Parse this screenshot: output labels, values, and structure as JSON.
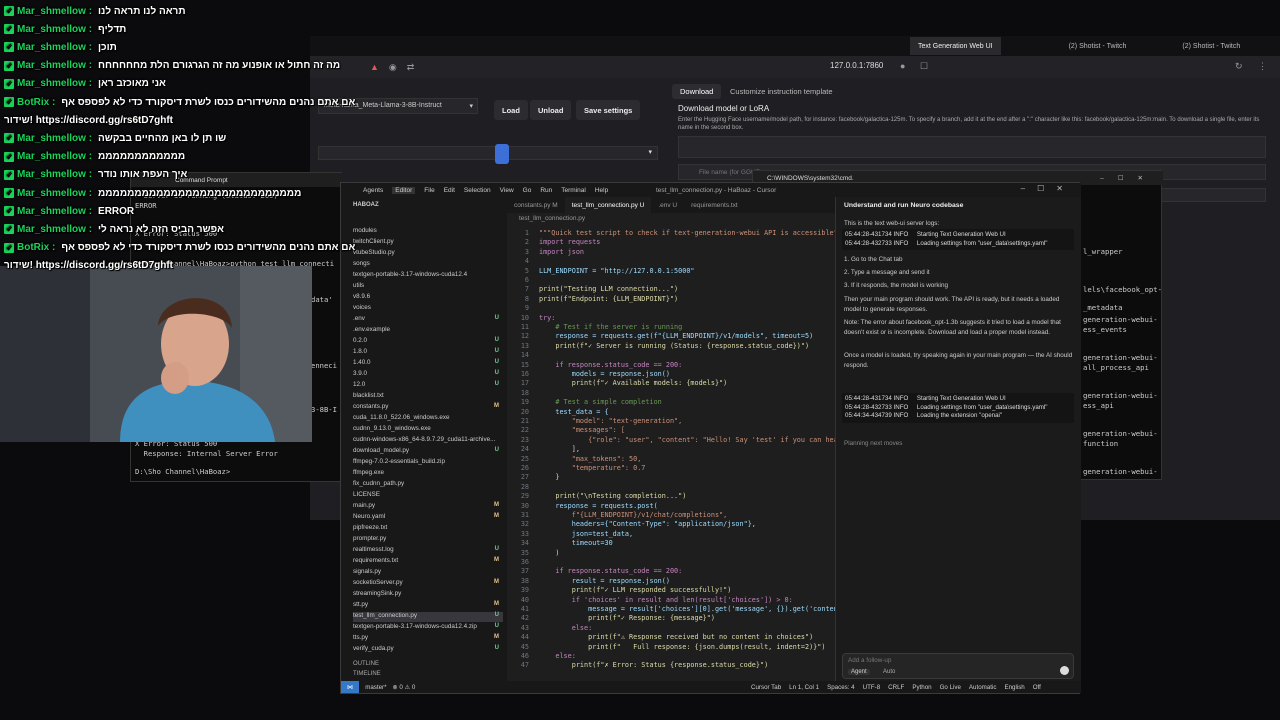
{
  "browser": {
    "tabs": [
      {
        "label": "Text Generation Web UI",
        "active": true
      },
      {
        "label": "(2) Shotist - Twitch",
        "active": false
      },
      {
        "label": "(2) Shotist - Twitch",
        "active": false
      }
    ],
    "url": "127.0.0.1:7860"
  },
  "webui": {
    "model_name": "meta-llama_Meta-Llama-3-8B-Instruct",
    "load_label": "Load",
    "unload_label": "Unload",
    "save_label": "Save settings",
    "tab_download": "Download",
    "tab_customize": "Customize instruction template",
    "download_heading": "Download model or LoRA",
    "download_help": "Enter the Hugging Face username/model path, for instance: facebook/galactica-125m. To specify a branch, add it at the end after a \":\" character like this: facebook/galactica-125m:main. To download a single file, enter its name in the second box.",
    "file_name_placeholder": "File name (for GGUF",
    "side_items": [
      "l_wrapper",
      "lels\\facebook_opt-",
      "_metadata",
      "generation-webui-",
      "ess_events",
      "generation-webui-",
      "all_process_api",
      "generation-webui-",
      "ess_api",
      "generation-webui-",
      "function",
      "generation-webui-"
    ],
    "left_labels": [
      "Model",
      "Main option",
      "Character",
      "Must be greater than 0",
      "ctx-size"
    ]
  },
  "cursor": {
    "menu": [
      "Agents",
      "Editor",
      "File",
      "Edit",
      "Selection",
      "View",
      "Go",
      "Run",
      "Terminal",
      "Help"
    ],
    "title": "test_llm_connection.py - HaBoaz - Cursor",
    "explorer_title": "HABOAZ",
    "files": [
      {
        "name": "modules",
        "badge": ""
      },
      {
        "name": "twitchClient.py",
        "badge": ""
      },
      {
        "name": "vtubeStudio.py",
        "badge": ""
      },
      {
        "name": "songs",
        "badge": ""
      },
      {
        "name": "textgen-portable-3.17-windows-cuda12.4",
        "badge": ""
      },
      {
        "name": "utils",
        "badge": ""
      },
      {
        "name": "v8.9.6",
        "badge": ""
      },
      {
        "name": "voices",
        "badge": ""
      },
      {
        "name": ".env",
        "badge": "U"
      },
      {
        "name": ".env.example",
        "badge": ""
      },
      {
        "name": "0.2.0",
        "badge": "U"
      },
      {
        "name": "1.8.0",
        "badge": "U"
      },
      {
        "name": "1.40.0",
        "badge": "U"
      },
      {
        "name": "3.9.0",
        "badge": "U"
      },
      {
        "name": "12.0",
        "badge": "U"
      },
      {
        "name": "blacklist.txt",
        "badge": ""
      },
      {
        "name": "constants.py",
        "badge": "M"
      },
      {
        "name": "cuda_11.8.0_522.06_windows.exe",
        "badge": ""
      },
      {
        "name": "cudnn_9.13.0_windows.exe",
        "badge": ""
      },
      {
        "name": "cudnn-windows-x86_64-8.9.7.29_cuda11-archive...",
        "badge": ""
      },
      {
        "name": "download_model.py",
        "badge": "U"
      },
      {
        "name": "ffmpeg-7.0.2-essentials_build.zip",
        "badge": ""
      },
      {
        "name": "ffmpeg.exe",
        "badge": ""
      },
      {
        "name": "fix_cudnn_path.py",
        "badge": ""
      },
      {
        "name": "LICENSE",
        "badge": ""
      },
      {
        "name": "main.py",
        "badge": "M"
      },
      {
        "name": "Neuro.yaml",
        "badge": "M"
      },
      {
        "name": "pipfreeze.txt",
        "badge": ""
      },
      {
        "name": "prompter.py",
        "badge": ""
      },
      {
        "name": "realtimesst.log",
        "badge": "U"
      },
      {
        "name": "requirements.txt",
        "badge": "M"
      },
      {
        "name": "signals.py",
        "badge": ""
      },
      {
        "name": "socketioServer.py",
        "badge": "M"
      },
      {
        "name": "streamingSink.py",
        "badge": ""
      },
      {
        "name": "stt.py",
        "badge": "M"
      },
      {
        "name": "test_llm_connection.py",
        "badge": "U",
        "selected": true
      },
      {
        "name": "textgen-portable-3.17-windows-cuda12.4.zip",
        "badge": "U"
      },
      {
        "name": "tts.py",
        "badge": "M"
      },
      {
        "name": "verify_cuda.py",
        "badge": "U"
      }
    ],
    "outline_label": "OUTLINE",
    "timeline_label": "TIMELINE",
    "editor_tabs": [
      {
        "label": "constants.py M",
        "active": false
      },
      {
        "label": "test_llm_connection.py U",
        "active": true
      },
      {
        "label": ".env U",
        "active": false
      },
      {
        "label": "requirements.txt",
        "active": false
      }
    ],
    "breadcrumb": "test_llm_connection.py",
    "code_lines": [
      {
        "n": "1",
        "t": "\"\"\"Quick test script to check if text-generation-webui API is accessible\"\"\"",
        "c": "st"
      },
      {
        "n": "2",
        "t": "import requests",
        "c": "kw"
      },
      {
        "n": "3",
        "t": "import json",
        "c": "kw"
      },
      {
        "n": "4",
        "t": "",
        "c": ""
      },
      {
        "n": "5",
        "t": "LLM_ENDPOINT = \"http://127.0.0.1:5000\"",
        "c": "vr"
      },
      {
        "n": "6",
        "t": "",
        "c": ""
      },
      {
        "n": "7",
        "t": "print(\"Testing LLM connection...\")",
        "c": "fn"
      },
      {
        "n": "8",
        "t": "print(f\"Endpoint: {LLM_ENDPOINT}\")",
        "c": "fn"
      },
      {
        "n": "9",
        "t": "",
        "c": ""
      },
      {
        "n": "10",
        "t": "try:",
        "c": "kw"
      },
      {
        "n": "11",
        "t": "    # Test if the server is running",
        "c": "cm"
      },
      {
        "n": "12",
        "t": "    response = requests.get(f\"{LLM_ENDPOINT}/v1/models\", timeout=5)",
        "c": "vr"
      },
      {
        "n": "13",
        "t": "    print(f\"✓ Server is running (Status: {response.status_code})\")",
        "c": "fn"
      },
      {
        "n": "14",
        "t": "",
        "c": ""
      },
      {
        "n": "15",
        "t": "    if response.status_code == 200:",
        "c": "kw"
      },
      {
        "n": "16",
        "t": "        models = response.json()",
        "c": "vr"
      },
      {
        "n": "17",
        "t": "        print(f\"✓ Available models: {models}\")",
        "c": "fn"
      },
      {
        "n": "18",
        "t": "",
        "c": ""
      },
      {
        "n": "19",
        "t": "    # Test a simple completion",
        "c": "cm"
      },
      {
        "n": "20",
        "t": "    test_data = {",
        "c": "vr"
      },
      {
        "n": "21",
        "t": "        \"model\": \"text-generation\",",
        "c": "st"
      },
      {
        "n": "22",
        "t": "        \"messages\": [",
        "c": "st"
      },
      {
        "n": "23",
        "t": "            {\"role\": \"user\", \"content\": \"Hello! Say 'test' if you can hear me",
        "c": "st"
      },
      {
        "n": "24",
        "t": "        ],",
        "c": ""
      },
      {
        "n": "25",
        "t": "        \"max_tokens\": 50,",
        "c": "st"
      },
      {
        "n": "26",
        "t": "        \"temperature\": 0.7",
        "c": "st"
      },
      {
        "n": "27",
        "t": "    }",
        "c": ""
      },
      {
        "n": "28",
        "t": "",
        "c": ""
      },
      {
        "n": "29",
        "t": "    print(\"\\nTesting completion...\")",
        "c": "fn"
      },
      {
        "n": "30",
        "t": "    response = requests.post(",
        "c": "vr"
      },
      {
        "n": "31",
        "t": "        f\"{LLM_ENDPOINT}/v1/chat/completions\",",
        "c": "st"
      },
      {
        "n": "32",
        "t": "        headers={\"Content-Type\": \"application/json\"},",
        "c": "vr"
      },
      {
        "n": "33",
        "t": "        json=test_data,",
        "c": "vr"
      },
      {
        "n": "34",
        "t": "        timeout=30",
        "c": "vr"
      },
      {
        "n": "35",
        "t": "    )",
        "c": ""
      },
      {
        "n": "36",
        "t": "",
        "c": ""
      },
      {
        "n": "37",
        "t": "    if response.status_code == 200:",
        "c": "kw"
      },
      {
        "n": "38",
        "t": "        result = response.json()",
        "c": "vr"
      },
      {
        "n": "39",
        "t": "        print(f\"✓ LLM responded successfully!\")",
        "c": "fn"
      },
      {
        "n": "40",
        "t": "        if 'choices' in result and len(result['choices']) > 0:",
        "c": "kw"
      },
      {
        "n": "41",
        "t": "            message = result['choices'][0].get('message', {}).get('content',",
        "c": "vr"
      },
      {
        "n": "42",
        "t": "            print(f\"✓ Response: {message}\")",
        "c": "fn"
      },
      {
        "n": "43",
        "t": "        else:",
        "c": "kw"
      },
      {
        "n": "44",
        "t": "            print(f\"⚠ Response received but no content in choices\")",
        "c": "fn"
      },
      {
        "n": "45",
        "t": "            print(f\"   Full response: {json.dumps(result, indent=2)}\")",
        "c": "fn"
      },
      {
        "n": "46",
        "t": "    else:",
        "c": "kw"
      },
      {
        "n": "47",
        "t": "        print(f\"✗ Error: Status {response.status_code}\")",
        "c": "fn"
      }
    ],
    "chat_title": "Understand and run Neuro codebase",
    "chat_intro": "This is the text web-ui server logs:",
    "log1": "05:44:28-431734 INFO     Starting Text Generation Web UI\n05:44:28-432733 INFO     Loading settings from \"user_data\\settings.yaml\"",
    "chat_steps": [
      "1. Go to the Chat tab",
      "2. Type a message and send it",
      "3. If it responds, the model is working"
    ],
    "chat_p1": "Then your main program should work. The API is ready, but it needs a loaded model to generate responses.",
    "chat_p2": "Note: The error about facebook_opt-1.3b suggests it tried to load a model that doesn't exist or is incomplete. Download and load a proper model instead.",
    "chat_p3": "Once a model is loaded, try speaking again in your main program — the AI should respond.",
    "log2": "05:44:28-431734 INFO     Starting Text Generation Web UI\n05:44:28-432733 INFO     Loading settings from \"user_data\\settings.yaml\"\n05:44:34-434739 INFO     Loading the extension \"openai\"",
    "planning": "Planning next moves",
    "followup_placeholder": "Add a follow-up",
    "agent_label": "Agent",
    "auto_label": "Auto",
    "status": {
      "branch": "master*",
      "errors": "⊗ 0 ⚠ 0",
      "right": [
        "Cursor Tab",
        "Ln 1, Col 1",
        "Spaces: 4",
        "UTF-8",
        "CRLF",
        "Python",
        "Go Live",
        "Automatic",
        "English",
        "Off"
      ]
    }
  },
  "terminal": {
    "title": "Command Prompt",
    "lines": [
      "✓ Server is running (Status: 200)",
      "ERROR",
      "X Error: Status 500",
      "",
      "",
      "D:\\Sho Channel\\HaBoaz>python test_llm_connecti",
      "",
      "",
      "",
      "",
      "",
      "",
      "",
      "",
      "",
      "",
      "",
      "",
      "X Error: Status 500",
      "  Response: Internal Server Error",
      "",
      "D:\\Sho Channel\\HaBoaz>"
    ],
    "fragments": [
      "'list', 'data'",
      "data'",
      "enneci",
      "ted",
      "3-8B-I",
      "data'"
    ]
  },
  "terminal2": {
    "title": "C:\\WINDOWS\\system32\\cmd."
  },
  "chat_overlay": [
    {
      "user": "Mar_shmellow",
      "msg": "תראה לנו תראה לנו"
    },
    {
      "user": "Mar_shmellow",
      "msg": "תדליף"
    },
    {
      "user": "Mar_shmellow",
      "msg": "תוכן"
    },
    {
      "user": "Mar_shmellow",
      "msg": "מה זה חתול או אופנוע מה זה הגרגורם הלת מחחחחחח"
    },
    {
      "user": "Mar_shmellow",
      "msg": "אני מאוכזב ראן"
    },
    {
      "user": "BotRix",
      "msg": "אם אתם נהנים מהשידורים כנסו לשרת דיסקורד כדי לא לפספס אף",
      "bot": true
    },
    {
      "user": "",
      "msg": "שידור! https://discord.gg/rs6tD7ghft"
    },
    {
      "user": "Mar_shmellow",
      "msg": "שו תן לו באן מהחיים בבקשה"
    },
    {
      "user": "Mar_shmellow",
      "msg": "ממממממממממממ"
    },
    {
      "user": "Mar_shmellow",
      "msg": "איך העפת אותו נודר"
    },
    {
      "user": "Mar_shmellow",
      "msg": "ממממממממממממממממממממממממממממ"
    },
    {
      "user": "Mar_shmellow",
      "msg": "ERROR"
    },
    {
      "user": "Mar_shmellow",
      "msg": "אפשר הביס הזה לא נראה לי"
    },
    {
      "user": "BotRix",
      "msg": "אם אתם נהנים מהשידורים כנסו לשרת דיסקורד כדי לא לפספס אף",
      "bot": true
    },
    {
      "user": "",
      "msg": "שידור! https://discord.gg/rs6tD7ghft"
    }
  ]
}
